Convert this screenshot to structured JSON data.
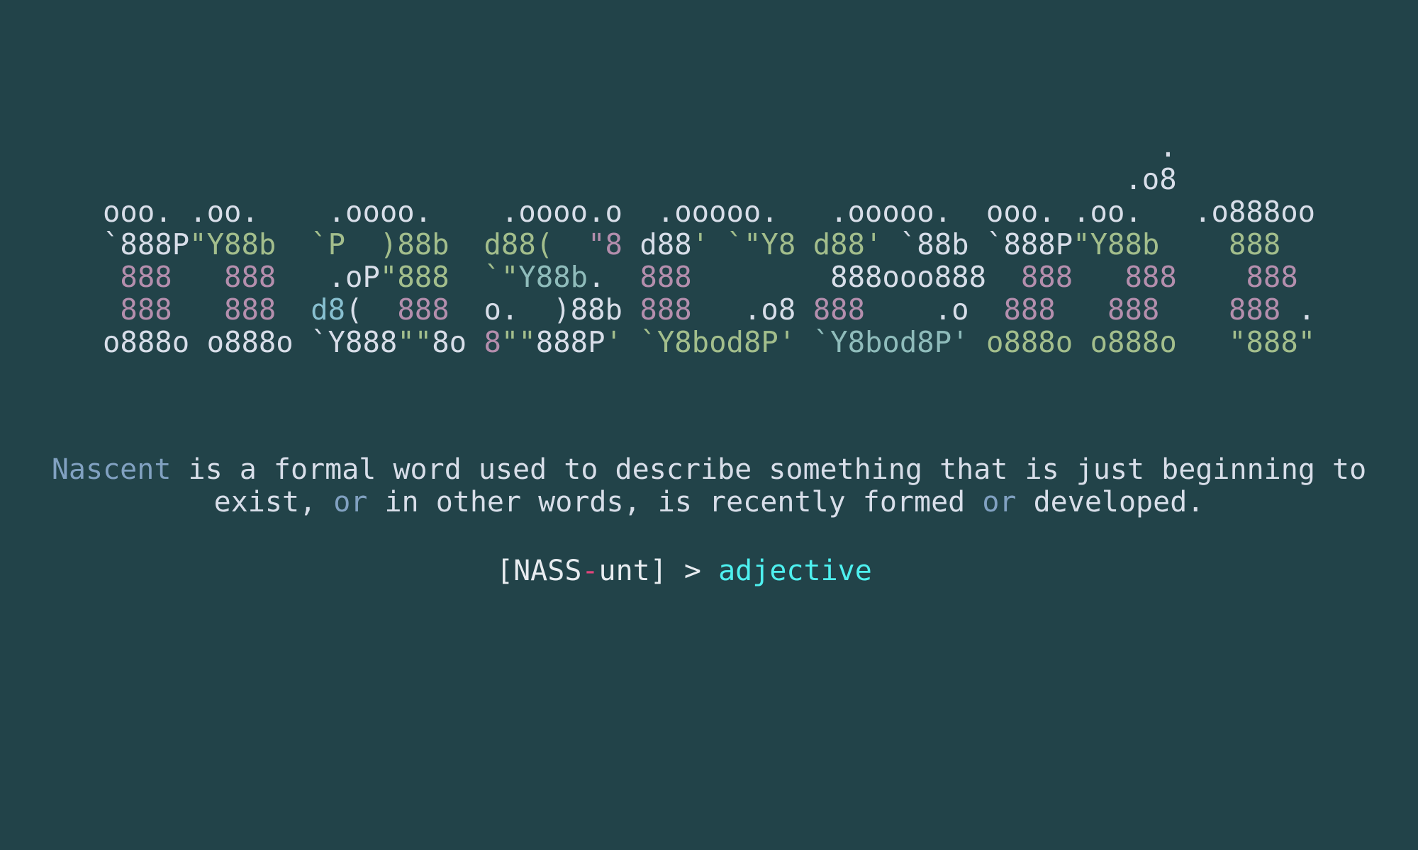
{
  "colors": {
    "background": "#224349",
    "text": "#d8dee9",
    "green": "#a3be8c",
    "pink": "#b48ead",
    "cyan": "#88c0d0",
    "teal": "#8fbcbb",
    "blue": "#81a1c1",
    "bright_cyan": "#4ef0ef",
    "red": "#e0447a"
  },
  "banner": {
    "word": "nascent",
    "lines": [
      [
        {
          "t": "                                                             .",
          "c": "text"
        }
      ],
      [
        {
          "t": "                                                           .o8",
          "c": "text"
        }
      ],
      [
        {
          "t": "ooo. .oo.    .oooo.    .oooo.o  .ooooo.   .ooooo.  ooo. .oo.   .o888oo",
          "c": "text"
        }
      ],
      [
        {
          "t": "`888P",
          "c": "text"
        },
        {
          "t": "\"Y88b  `P  )88b  d88(  ",
          "c": "green"
        },
        {
          "t": "\"8",
          "c": "pink"
        },
        {
          "t": " d88",
          "c": "text"
        },
        {
          "t": "' ",
          "c": "green"
        },
        {
          "t": "`\"Y8 d88' ",
          "c": "green"
        },
        {
          "t": "`88b `888P",
          "c": "text"
        },
        {
          "t": "\"Y88b    888",
          "c": "green"
        }
      ],
      [
        {
          "t": " 888   888",
          "c": "pink"
        },
        {
          "t": "   .oP",
          "c": "text"
        },
        {
          "t": "\"888  ",
          "c": "green"
        },
        {
          "t": "`\"",
          "c": "green"
        },
        {
          "t": "Y88b",
          "c": "teal"
        },
        {
          "t": ".  ",
          "c": "text"
        },
        {
          "t": "888",
          "c": "pink"
        },
        {
          "t": "        888ooo888  ",
          "c": "text"
        },
        {
          "t": "888   888    888",
          "c": "pink"
        }
      ],
      [
        {
          "t": " 888   888",
          "c": "pink"
        },
        {
          "t": "  ",
          "c": "text"
        },
        {
          "t": "d8",
          "c": "cyan"
        },
        {
          "t": "(  ",
          "c": "text"
        },
        {
          "t": "888",
          "c": "pink"
        },
        {
          "t": "  o.  )88b ",
          "c": "text"
        },
        {
          "t": "888",
          "c": "pink"
        },
        {
          "t": "   .o8 ",
          "c": "text"
        },
        {
          "t": "888",
          "c": "pink"
        },
        {
          "t": "    .o  ",
          "c": "text"
        },
        {
          "t": "888   888    888",
          "c": "pink"
        },
        {
          "t": " .",
          "c": "text"
        }
      ],
      [
        {
          "t": "o888o o888o `Y888",
          "c": "text"
        },
        {
          "t": "\"\"",
          "c": "green"
        },
        {
          "t": "8o ",
          "c": "text"
        },
        {
          "t": "8",
          "c": "pink"
        },
        {
          "t": "\"\"",
          "c": "green"
        },
        {
          "t": "888P",
          "c": "text"
        },
        {
          "t": "' `Y8bod8P' ",
          "c": "green"
        },
        {
          "t": "`Y8bod8P' ",
          "c": "teal"
        },
        {
          "t": "o888o o888o   \"888\"",
          "c": "green"
        }
      ]
    ]
  },
  "description": {
    "lines": [
      [
        {
          "t": "Nascent",
          "c": "blue"
        },
        {
          "t": " is a formal word used to describe something that is just beginning to",
          "c": "text"
        }
      ],
      [
        {
          "t": "exist, ",
          "c": "text"
        },
        {
          "t": "or",
          "c": "blue"
        },
        {
          "t": " in other words, is recently formed ",
          "c": "text"
        },
        {
          "t": "or",
          "c": "blue"
        },
        {
          "t": " developed.",
          "c": "text"
        }
      ]
    ]
  },
  "pronunciation": {
    "open": "[NASS",
    "hyphen": "-",
    "close": "unt] > ",
    "part_of_speech": "adjective"
  }
}
